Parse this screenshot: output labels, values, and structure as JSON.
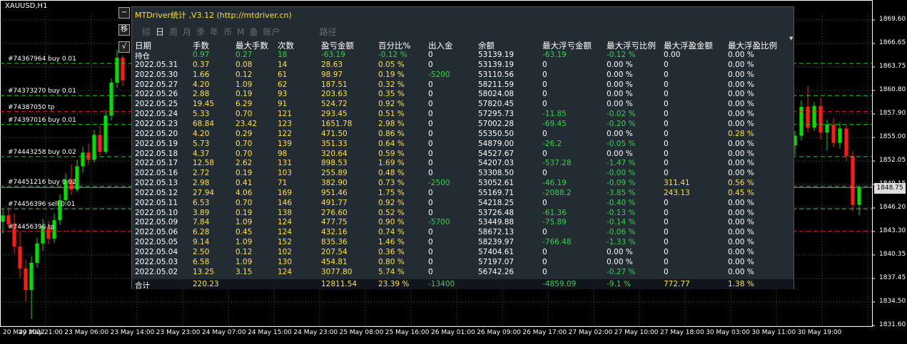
{
  "symbol": "XAUUSD,H1",
  "colors": {
    "bg": "#000000",
    "grid": "#555555",
    "bull": "#00e000",
    "bear": "#ff1a1a",
    "white": "#ffffff",
    "yellow": "#ffe040",
    "green": "#33d34a",
    "panel": "#232b33"
  },
  "order_lines": [
    {
      "label": "#74367964 buy 0.01",
      "price": 1864.2,
      "color": "green"
    },
    {
      "label": "#74373270 buy 0.01",
      "price": 1860.2,
      "color": "green"
    },
    {
      "label": "#74387050 tp",
      "price": 1858.2,
      "color": "red"
    },
    {
      "label": "#74397016 buy 0.01",
      "price": 1856.6,
      "color": "green"
    },
    {
      "label": "#74443258 buy 0.02",
      "price": 1852.6,
      "color": "green"
    },
    {
      "label": "#74451216 buy 0.02",
      "price": 1848.9,
      "color": "green"
    },
    {
      "label": "#74456396 sell 0.01",
      "price": 1846.1,
      "color": "green"
    },
    {
      "label": "#74456396 tp",
      "price": 1843.3,
      "color": "red"
    }
  ],
  "price_axis": {
    "ticks": [
      "1869.60",
      "1866.65",
      "1863.75",
      "1860.80",
      "1857.90",
      "1855.00",
      "1852.05",
      "1849.15",
      "1846.20",
      "1843.30",
      "1840.35",
      "1837.45",
      "1834.50",
      "1831.60"
    ],
    "current": "1848.75"
  },
  "time_axis": [
    "20 May 2022",
    "20 May 21:00",
    "23 May 06:00",
    "23 May 14:00",
    "23 May 23:00",
    "24 May 07:00",
    "24 May 15:00",
    "24 May 23:00",
    "25 May 08:00",
    "25 May 16:00",
    "26 May 01:00",
    "26 May 09:00",
    "26 May 17:00",
    "27 May 02:00",
    "27 May 10:00",
    "27 May 18:00",
    "30 May 03:00",
    "30 May 11:00",
    "30 May 19:00"
  ],
  "chart_data": {
    "type": "candlestick",
    "ylim": [
      1831.6,
      1869.6
    ],
    "candles": [
      [
        1844.5,
        1846.0,
        1843.0,
        1845.3
      ],
      [
        1845.3,
        1846.2,
        1843.8,
        1844.2
      ],
      [
        1844.2,
        1845.5,
        1840.5,
        1841.4
      ],
      [
        1841.4,
        1843.2,
        1837.5,
        1838.7
      ],
      [
        1838.7,
        1839.8,
        1834.6,
        1836.0
      ],
      [
        1836.0,
        1840.2,
        1832.4,
        1839.4
      ],
      [
        1839.4,
        1842.5,
        1838.8,
        1841.8
      ],
      [
        1841.8,
        1844.8,
        1840.9,
        1843.9
      ],
      [
        1843.9,
        1844.6,
        1841.7,
        1842.4
      ],
      [
        1842.4,
        1845.5,
        1841.9,
        1844.7
      ],
      [
        1844.7,
        1847.9,
        1844.1,
        1847.2
      ],
      [
        1847.2,
        1850.5,
        1846.6,
        1849.7
      ],
      [
        1849.7,
        1851.6,
        1847.8,
        1848.5
      ],
      [
        1848.5,
        1852.2,
        1848.2,
        1851.4
      ],
      [
        1851.4,
        1853.8,
        1850.6,
        1853.1
      ],
      [
        1853.1,
        1854.2,
        1851.6,
        1852.2
      ],
      [
        1852.2,
        1855.9,
        1851.9,
        1855.3
      ],
      [
        1855.3,
        1856.4,
        1852.7,
        1853.2
      ],
      [
        1853.2,
        1858.4,
        1852.9,
        1857.7
      ],
      [
        1857.7,
        1862.3,
        1857.1,
        1861.8
      ],
      [
        1861.8,
        1865.9,
        1861.2,
        1864.9
      ],
      [
        1864.9,
        1865.2,
        1861.4,
        1862.1
      ],
      [
        1854.0,
        1855.8,
        1852.8,
        1855.2
      ],
      [
        1855.2,
        1859.6,
        1854.6,
        1858.8
      ],
      [
        1858.8,
        1861.4,
        1855.6,
        1856.2
      ],
      [
        1856.2,
        1859.4,
        1855.8,
        1858.9
      ],
      [
        1858.9,
        1859.9,
        1854.7,
        1855.6
      ],
      [
        1855.6,
        1857.2,
        1853.4,
        1856.6
      ],
      [
        1856.6,
        1857.4,
        1853.8,
        1854.3
      ],
      [
        1854.3,
        1856.9,
        1853.6,
        1856.1
      ],
      [
        1856.1,
        1856.6,
        1852.1,
        1852.7
      ],
      [
        1852.7,
        1853.3,
        1845.8,
        1846.6
      ],
      [
        1846.6,
        1849.0,
        1845.3,
        1848.7
      ]
    ]
  },
  "panel": {
    "title": "MTDriver统计 ,V3.12 (http://mtdriver.cn)",
    "tabs": [
      "综",
      "日",
      "周",
      "月",
      "季",
      "年",
      "币",
      "M",
      "备",
      "账户"
    ],
    "path_label": "路径",
    "columns": [
      "日期",
      "手数",
      "最大手数",
      "次数",
      "盈亏金额",
      "百分比%",
      "出入金",
      "余额",
      "最大浮亏金额",
      "最大浮亏比例",
      "最大浮盈金额",
      "最大浮盈比例"
    ],
    "rows": [
      [
        "持仓",
        "0.97",
        "0.27",
        "18",
        "-63.19",
        "-0.12 %",
        "0",
        "53139.19",
        "-63.19",
        "-0.12 %",
        "0.00",
        "0.00 %"
      ],
      [
        "2022.05.31",
        "0.37",
        "0.08",
        "14",
        "28.63",
        "0.05 %",
        "0",
        "53139.19",
        "0",
        "0.00 %",
        "0",
        "0.00 %"
      ],
      [
        "2022.05.30",
        "1.66",
        "0.12",
        "61",
        "98.97",
        "0.19 %",
        "-5200",
        "53110.56",
        "0",
        "0.00 %",
        "0",
        "0.00 %"
      ],
      [
        "2022.05.27",
        "4.20",
        "1.09",
        "62",
        "187.51",
        "0.32 %",
        "0",
        "58211.59",
        "0",
        "0.00 %",
        "0",
        "0.00 %"
      ],
      [
        "2022.05.26",
        "2.88",
        "0.19",
        "93",
        "203.63",
        "0.35 %",
        "0",
        "58024.08",
        "0",
        "0.00 %",
        "0",
        "0.00 %"
      ],
      [
        "2022.05.25",
        "19.45",
        "6.29",
        "91",
        "524.72",
        "0.92 %",
        "0",
        "57820.45",
        "0",
        "0.00 %",
        "0",
        "0.00 %"
      ],
      [
        "2022.05.24",
        "5.33",
        "0.70",
        "121",
        "293.45",
        "0.51 %",
        "0",
        "57295.73",
        "-11.85",
        "-0.02 %",
        "0",
        "0.00 %"
      ],
      [
        "2022.05.23",
        "68.84",
        "23.42",
        "123",
        "1651.78",
        "2.98 %",
        "0",
        "57002.28",
        "-69.45",
        "-0.20 %",
        "0",
        "0.00 %"
      ],
      [
        "2022.05.20",
        "4.20",
        "0.29",
        "122",
        "471.50",
        "0.86 %",
        "0",
        "55350.50",
        "0",
        "0.00 %",
        "0",
        "0.28 %"
      ],
      [
        "2022.05.19",
        "5.73",
        "0.70",
        "139",
        "351.33",
        "0.64 %",
        "0",
        "54879.00",
        "-26.2",
        "-0.05 %",
        "0",
        "0.00 %"
      ],
      [
        "2022.05.18",
        "4.37",
        "0.70",
        "98",
        "320.64",
        "0.59 %",
        "0",
        "54527.67",
        "0",
        "0.00 %",
        "0",
        "0.00 %"
      ],
      [
        "2022.05.17",
        "12.58",
        "2.62",
        "131",
        "898.53",
        "1.69 %",
        "0",
        "54207.03",
        "-537.28",
        "-1.47 %",
        "0",
        "0.00 %"
      ],
      [
        "2022.05.16",
        "2.72",
        "0.19",
        "103",
        "255.89",
        "0.48 %",
        "0",
        "53308.50",
        "0",
        "-0.00 %",
        "0",
        "0.00 %"
      ],
      [
        "2022.05.13",
        "2.98",
        "0.41",
        "71",
        "382.90",
        "0.73 %",
        "-2500",
        "53052.61",
        "-46.19",
        "-0.09 %",
        "311.41",
        "0.56 %"
      ],
      [
        "2022.05.12",
        "27.94",
        "4.06",
        "169",
        "951.46",
        "1.75 %",
        "0",
        "55169.71",
        "-2088.2",
        "-3.85 %",
        "243.13",
        "0.45 %"
      ],
      [
        "2022.05.11",
        "6.53",
        "0.70",
        "146",
        "491.77",
        "0.92 %",
        "0",
        "54218.25",
        "0",
        "-0.40 %",
        "0",
        "0.00 %"
      ],
      [
        "2022.05.10",
        "3.89",
        "0.19",
        "138",
        "276.60",
        "0.52 %",
        "0",
        "53726.48",
        "-61.36",
        "-0.13 %",
        "0",
        "0.00 %"
      ],
      [
        "2022.05.09",
        "7.84",
        "1.09",
        "124",
        "477.75",
        "0.90 %",
        "-5700",
        "53449.88",
        "-75.89",
        "-0.14 %",
        "0",
        "0.00 %"
      ],
      [
        "2022.05.06",
        "6.28",
        "0.45",
        "124",
        "432.16",
        "0.74 %",
        "0",
        "58672.13",
        "0",
        "-0.06 %",
        "0",
        "0.00 %"
      ],
      [
        "2022.05.05",
        "9.14",
        "1.09",
        "152",
        "835.36",
        "1.46 %",
        "0",
        "58239.97",
        "-766.48",
        "-1.33 %",
        "0",
        "0.00 %"
      ],
      [
        "2022.05.04",
        "2.50",
        "0.12",
        "102",
        "207.54",
        "0.36 %",
        "0",
        "57404.61",
        "0",
        "0.00 %",
        "0",
        "0.00 %"
      ],
      [
        "2022.05.03",
        "6.58",
        "1.09",
        "130",
        "454.81",
        "0.80 %",
        "0",
        "57197.07",
        "0",
        "0.00 %",
        "0",
        "0.00 %"
      ],
      [
        "2022.05.02",
        "13.25",
        "3.15",
        "124",
        "3077.80",
        "5.74 %",
        "0",
        "56742.26",
        "0",
        "-0.27 %",
        "0",
        "0.00 %"
      ]
    ],
    "total": [
      "合计",
      "220.23",
      "",
      "",
      "12811.54",
      "23.39 %",
      "-13400",
      "",
      "-4859.09",
      "-9.1 %",
      "772.77",
      "1.38 %"
    ]
  }
}
